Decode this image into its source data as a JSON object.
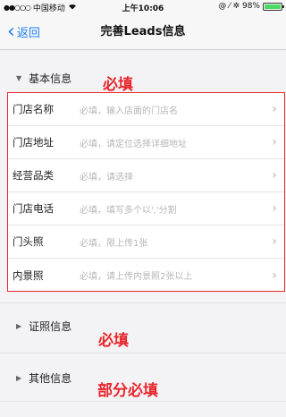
{
  "status_bar": {
    "signal": "●●○○○",
    "carrier": "中国移动",
    "wifi": "wifi-icon",
    "time": "上午10:06",
    "indicators": "@ ⁄ ✲",
    "battery_percent": "98%",
    "battery_level": 0.98,
    "battery_color": "#4cd964"
  },
  "nav": {
    "back_label": "返回",
    "title": "完善Leads信息",
    "accent_color": "#1a7cf5"
  },
  "sections": {
    "basic": {
      "label": "基本信息",
      "expanded": true
    },
    "license": {
      "label": "证照信息",
      "expanded": false
    },
    "other": {
      "label": "其他信息",
      "expanded": false
    }
  },
  "form": {
    "rows": [
      {
        "label": "门店名称",
        "placeholder": "必填，输入店面的门店名"
      },
      {
        "label": "门店地址",
        "placeholder": "必填，请定位选择详细地址"
      },
      {
        "label": "经营品类",
        "placeholder": "必填，请选择"
      },
      {
        "label": "门店电话",
        "placeholder": "必填，填写多个以','分割"
      },
      {
        "label": "门头照",
        "placeholder": "必填，限上传1张"
      },
      {
        "label": "内景照",
        "placeholder": "必填，请上传内景照2张以上"
      }
    ]
  },
  "annotations": {
    "basic_required": "必填",
    "license_required": "必填",
    "other_partial": "部分必填",
    "color": "#e8262b"
  }
}
